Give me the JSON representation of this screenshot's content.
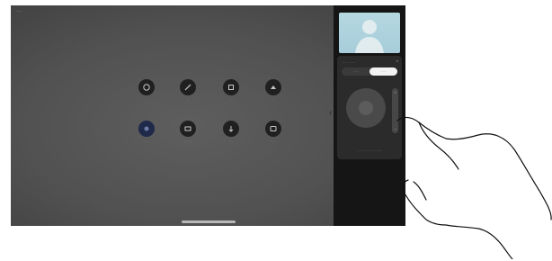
{
  "status_bar": {
    "text": "·····"
  },
  "apps": [
    {
      "name": "app-1",
      "label": "····",
      "icon": "app-1-icon"
    },
    {
      "name": "app-2",
      "label": "····",
      "icon": "app-2-icon"
    },
    {
      "name": "app-3",
      "label": "·····",
      "icon": "app-3-icon"
    },
    {
      "name": "app-4",
      "label": "····",
      "icon": "app-4-icon"
    },
    {
      "name": "app-5",
      "label": "·····",
      "icon": "app-5-icon"
    },
    {
      "name": "app-6",
      "label": "··········",
      "icon": "app-6-icon"
    },
    {
      "name": "app-7",
      "label": "······",
      "icon": "app-7-icon"
    },
    {
      "name": "app-8",
      "label": "······",
      "icon": "app-8-icon"
    }
  ],
  "panel": {
    "card_title": "······ ········",
    "segments": [
      "······",
      "······"
    ],
    "bottom_action": "········ ·· ··· ····· ·······",
    "zoom_plus": "+",
    "zoom_minus": "−"
  },
  "colors": {
    "panel_bg": "#151515",
    "screen_bg": "#515151",
    "selfview_bg": "#b5d8e2"
  }
}
